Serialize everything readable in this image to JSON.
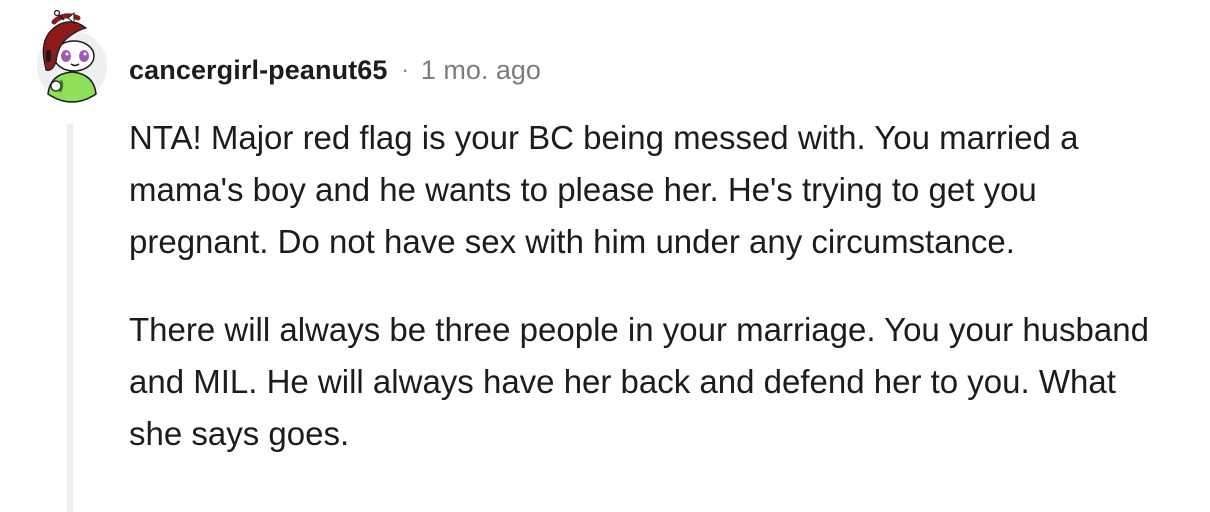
{
  "comment": {
    "author": "cancergirl-peanut65",
    "separator": "·",
    "timestamp": "1 mo. ago",
    "paragraphs": [
      "NTA! Major red flag is your BC being messed with. You married a mama's boy and he wants to please her. He's trying to get you pregnant. Do not have sex with him under any circumstance.",
      "There will always be three people in your marriage. You your husband and MIL. He will always have her back and defend her to you. What she says goes."
    ]
  },
  "avatar": {
    "icon": "snoo-avatar-icon",
    "colors": {
      "hair": "#8b1a1a",
      "shirt": "#8ee05a",
      "face": "#ffffff",
      "eyes": "#a05ab4"
    }
  },
  "colors": {
    "text": "#1c1c1c",
    "muted": "#7c7c7c",
    "thread_line": "#edeff1"
  }
}
